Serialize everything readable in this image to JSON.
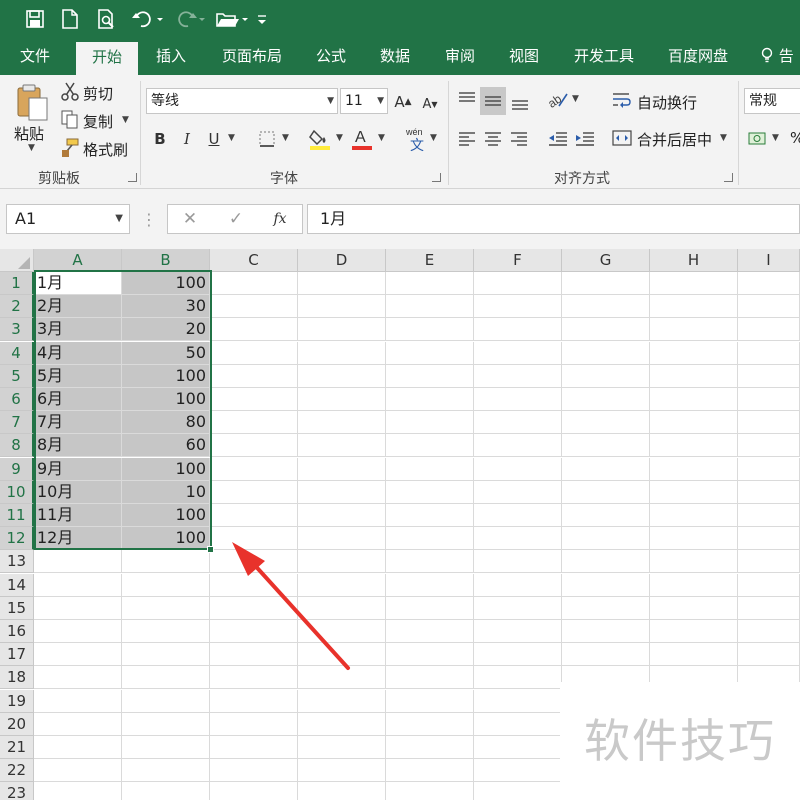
{
  "ribbon_tabs": [
    "文件",
    "开始",
    "插入",
    "页面布局",
    "公式",
    "数据",
    "审阅",
    "视图",
    "开发工具",
    "百度网盘",
    "告"
  ],
  "clipboard": {
    "paste": "粘贴",
    "cut": "剪切",
    "copy": "复制",
    "format_painter": "格式刷",
    "group": "剪贴板"
  },
  "font": {
    "name": "等线",
    "size": "11",
    "group": "字体",
    "bold": "B",
    "italic": "I",
    "underline": "U"
  },
  "alignment": {
    "wrap_text": "自动换行",
    "merge_center": "合并后居中",
    "group": "对齐方式"
  },
  "number": {
    "format": "常规"
  },
  "formula_bar": {
    "name_box": "A1",
    "fx": "fx",
    "content": "1月"
  },
  "columns": [
    "A",
    "B",
    "C",
    "D",
    "E",
    "F",
    "G",
    "H",
    "I"
  ],
  "rows": [
    "1",
    "2",
    "3",
    "4",
    "5",
    "6",
    "7",
    "8",
    "9",
    "10",
    "11",
    "12",
    "13",
    "14",
    "15",
    "16",
    "17",
    "18",
    "19",
    "20",
    "21",
    "22",
    "23"
  ],
  "cells": {
    "A": [
      "1月",
      "2月",
      "3月",
      "4月",
      "5月",
      "6月",
      "7月",
      "8月",
      "9月",
      "10月",
      "11月",
      "12月"
    ],
    "B": [
      "100",
      "30",
      "20",
      "50",
      "100",
      "100",
      "80",
      "60",
      "100",
      "10",
      "100",
      "100"
    ]
  },
  "selection": {
    "range": "A1:B12",
    "active_cell": "A1",
    "fill": "#c6c6c6",
    "border": "#217346"
  },
  "accent_color": "#217346",
  "arrow_color": "#e8322b",
  "watermark": "软件技巧"
}
